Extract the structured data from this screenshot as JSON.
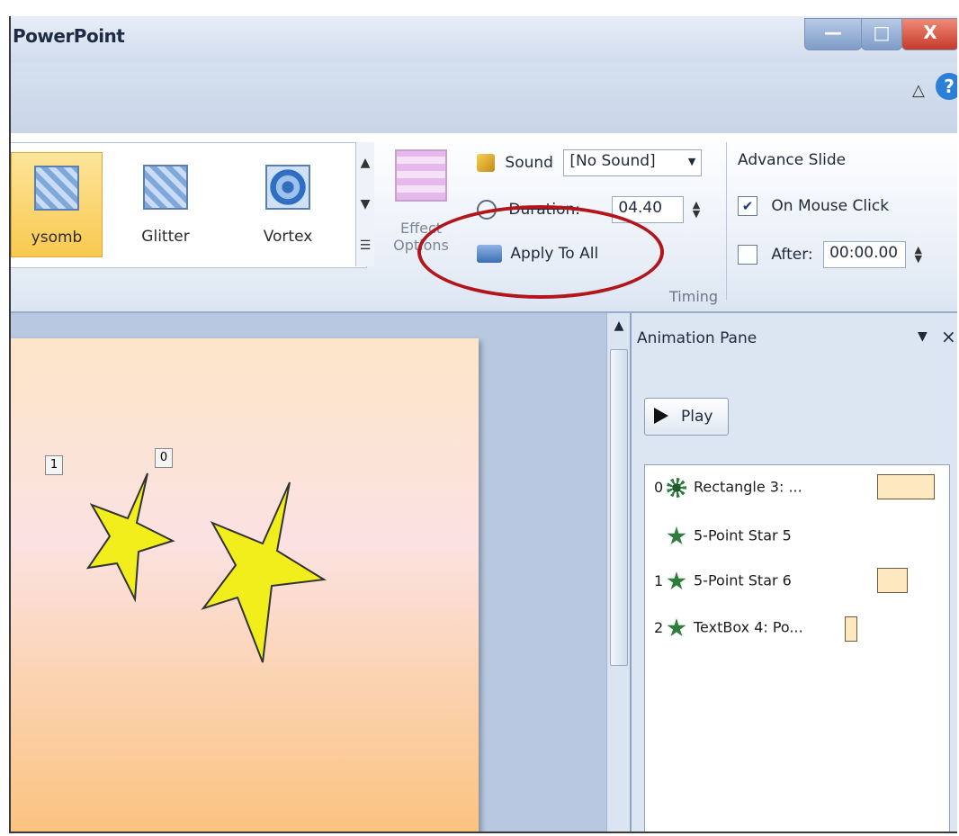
{
  "window": {
    "title": "PowerPoint",
    "minimize_glyph": "—",
    "maximize_glyph": "□",
    "close_glyph": "X",
    "help_glyph": "?",
    "collapse_glyph": "△"
  },
  "ribbon": {
    "gallery": [
      {
        "label": "ysomb",
        "selected": true,
        "icon": "honeycomb-transition-icon"
      },
      {
        "label": "Glitter",
        "selected": false,
        "icon": "glitter-transition-icon"
      },
      {
        "label": "Vortex",
        "selected": false,
        "icon": "vortex-transition-icon"
      }
    ],
    "effect_options_label": "Effect Options",
    "timing": {
      "sound_label": "Sound",
      "sound_value": "[No Sound]",
      "duration_label": "Duration:",
      "duration_value": "04.40",
      "apply_to_all_label": "Apply To All",
      "group_label": "Timing"
    },
    "advance_slide": {
      "header": "Advance Slide",
      "on_mouse_click_label": "On Mouse Click",
      "on_mouse_click_checked": true,
      "after_label": "After:",
      "after_checked": false,
      "after_value": "00:00.00"
    }
  },
  "slide": {
    "animation_tags": [
      "1",
      "0"
    ]
  },
  "animation_pane": {
    "title": "Animation Pane",
    "play_label": "Play",
    "items": [
      {
        "order": "0",
        "name": "Rectangle 3: ...",
        "effect_icon": "burst-effect-icon"
      },
      {
        "order": "",
        "name": "5-Point Star 5",
        "effect_icon": "star-effect-icon"
      },
      {
        "order": "1",
        "name": "5-Point Star 6",
        "effect_icon": "star-effect-icon"
      },
      {
        "order": "2",
        "name": "TextBox 4: Po...",
        "effect_icon": "star-effect-icon"
      }
    ]
  },
  "colors": {
    "highlight": "#b3151b",
    "selected_gallery": "#f7c94f",
    "star_fill": "#f2ee1c"
  }
}
